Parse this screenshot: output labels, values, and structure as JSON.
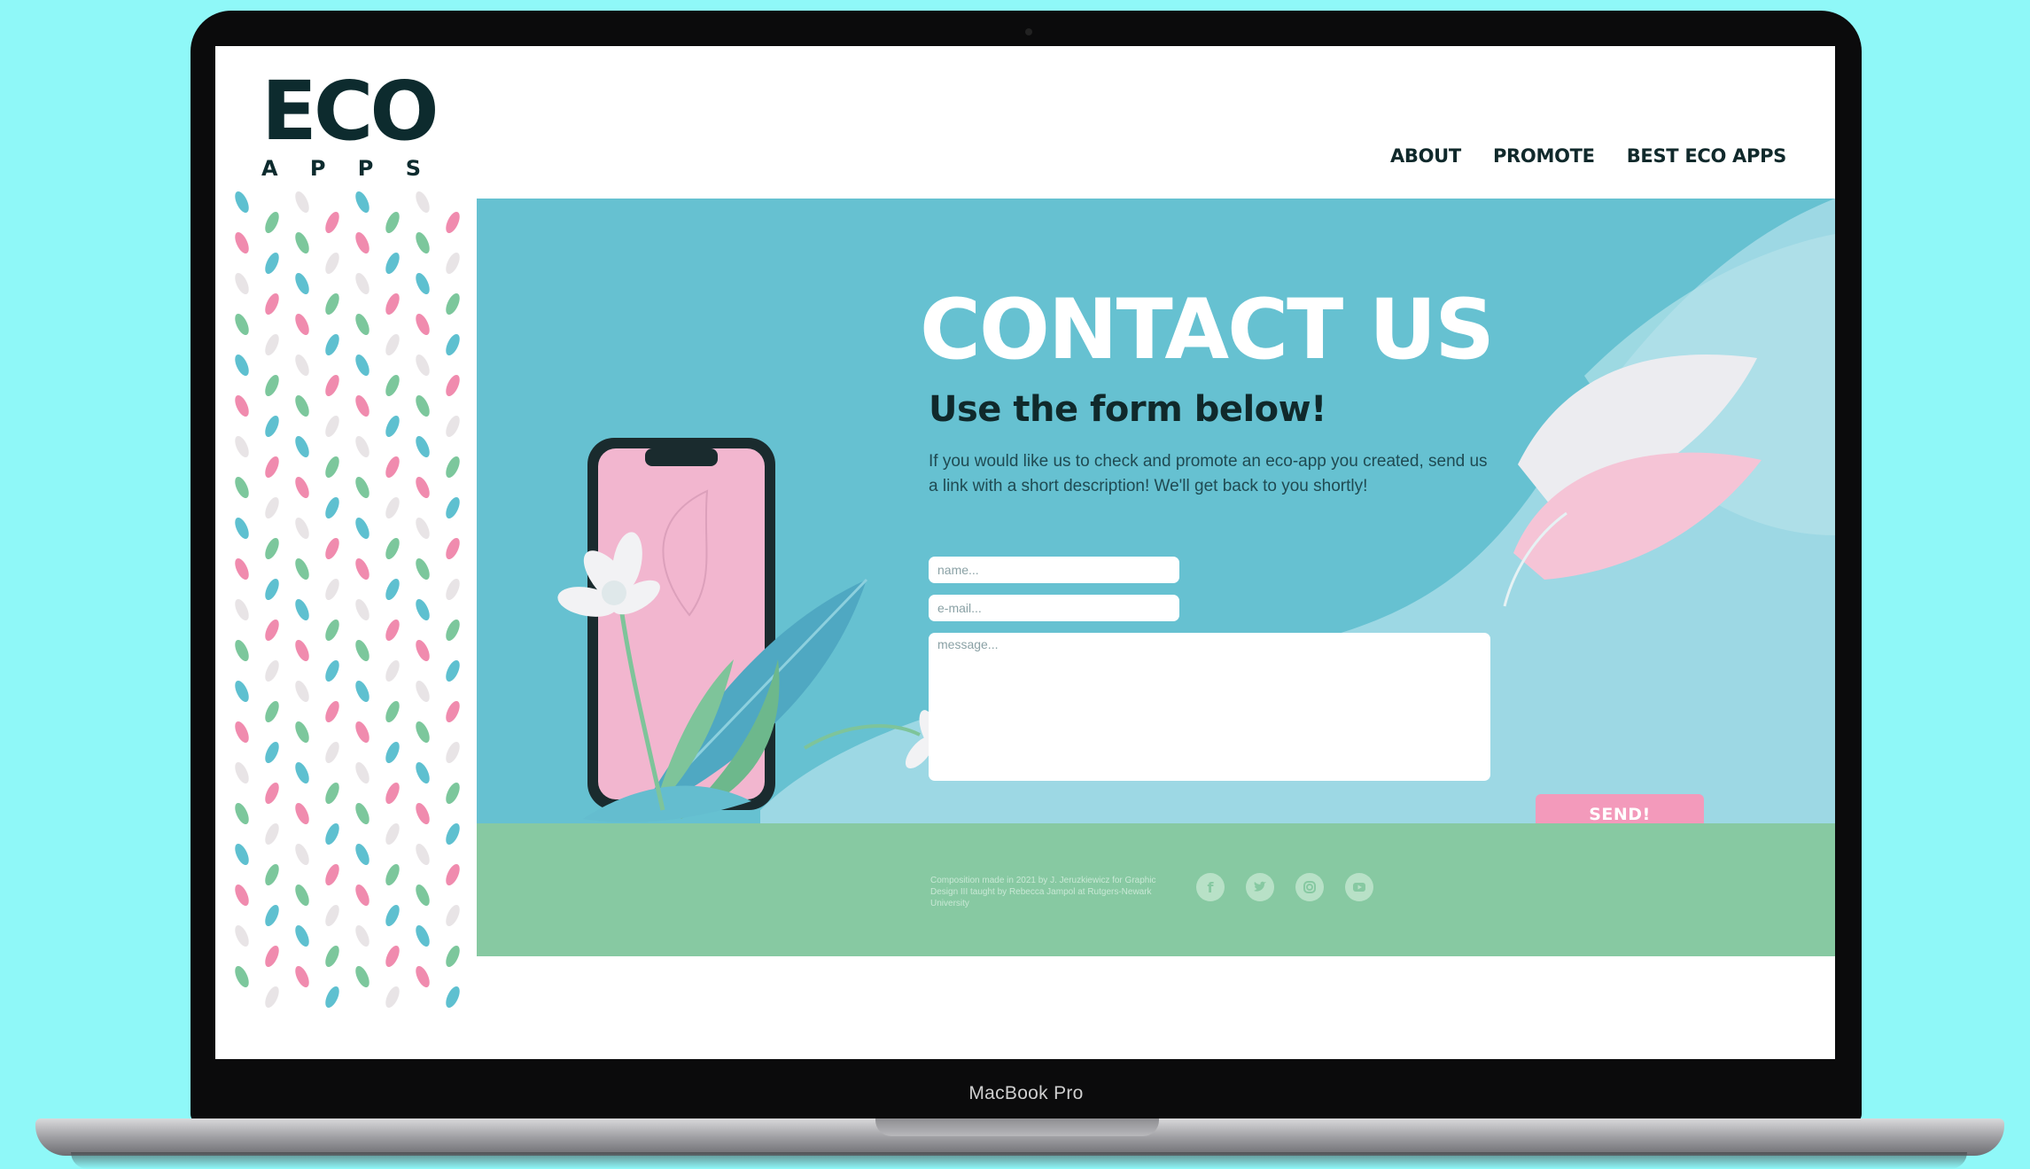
{
  "device": {
    "model_label": "MacBook Pro"
  },
  "brand": {
    "logo_word": "ECO",
    "logo_sub": [
      "A",
      "P",
      "P",
      "S"
    ]
  },
  "nav": {
    "items": [
      "ABOUT",
      "PROMOTE",
      "BEST ECO APPS"
    ]
  },
  "hero": {
    "title": "CONTACT US",
    "subtitle": "Use the form below!",
    "body": "If you would like us to check and promote an eco-app you created, send us a link with a short description! We'll get back to you shortly!"
  },
  "form": {
    "name_placeholder": "name...",
    "email_placeholder": "e-mail...",
    "message_placeholder": "message...",
    "send_label": "SEND!"
  },
  "footer": {
    "note": "Composition made in 2021 by J. Jeruzkiewicz for Graphic Design III taught by Rebecca Jampol at Rutgers-Newark University",
    "socials": [
      "facebook-icon",
      "twitter-icon",
      "instagram-icon",
      "youtube-icon"
    ]
  },
  "colors": {
    "background": "#8ff8f8",
    "hero": "#66c1d1",
    "footer": "#87c9a2",
    "accent_pink": "#f39abb",
    "ink": "#10292b"
  }
}
